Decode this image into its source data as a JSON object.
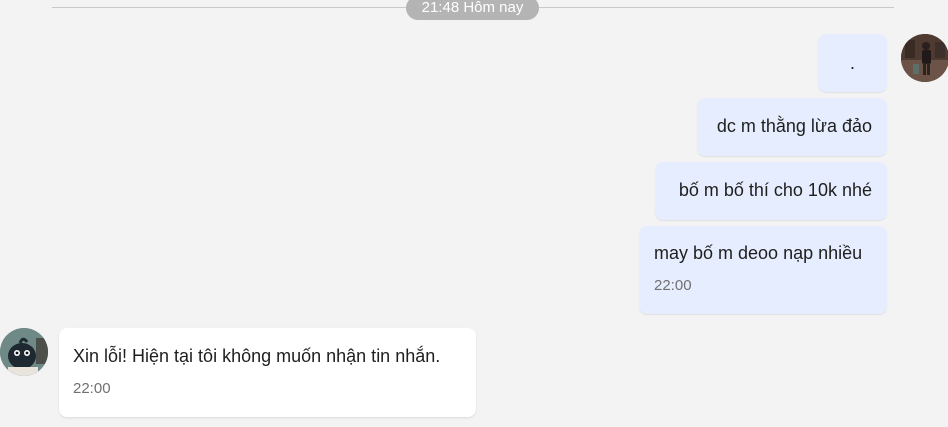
{
  "divider": {
    "time_label": "21:48 Hôm nay"
  },
  "messages_sent": [
    {
      "text": "."
    },
    {
      "text": "dc m thằng lừa đảo"
    },
    {
      "text": "bố m bố thí cho 10k nhé"
    },
    {
      "text": "may bố m deoo nạp nhiều",
      "time": "22:00"
    }
  ],
  "message_received": {
    "text": "Xin lỗi! Hiện tại tôi không muốn nhận tin nhắn.",
    "time": "22:00"
  },
  "colors": {
    "background": "#f3f3f3",
    "sent_bubble": "#e5edfe",
    "received_bubble": "#ffffff",
    "time_badge": "#b4b4b4"
  },
  "avatars": {
    "me": "user-photo-avatar",
    "bot": "bot-cartoon-avatar"
  }
}
